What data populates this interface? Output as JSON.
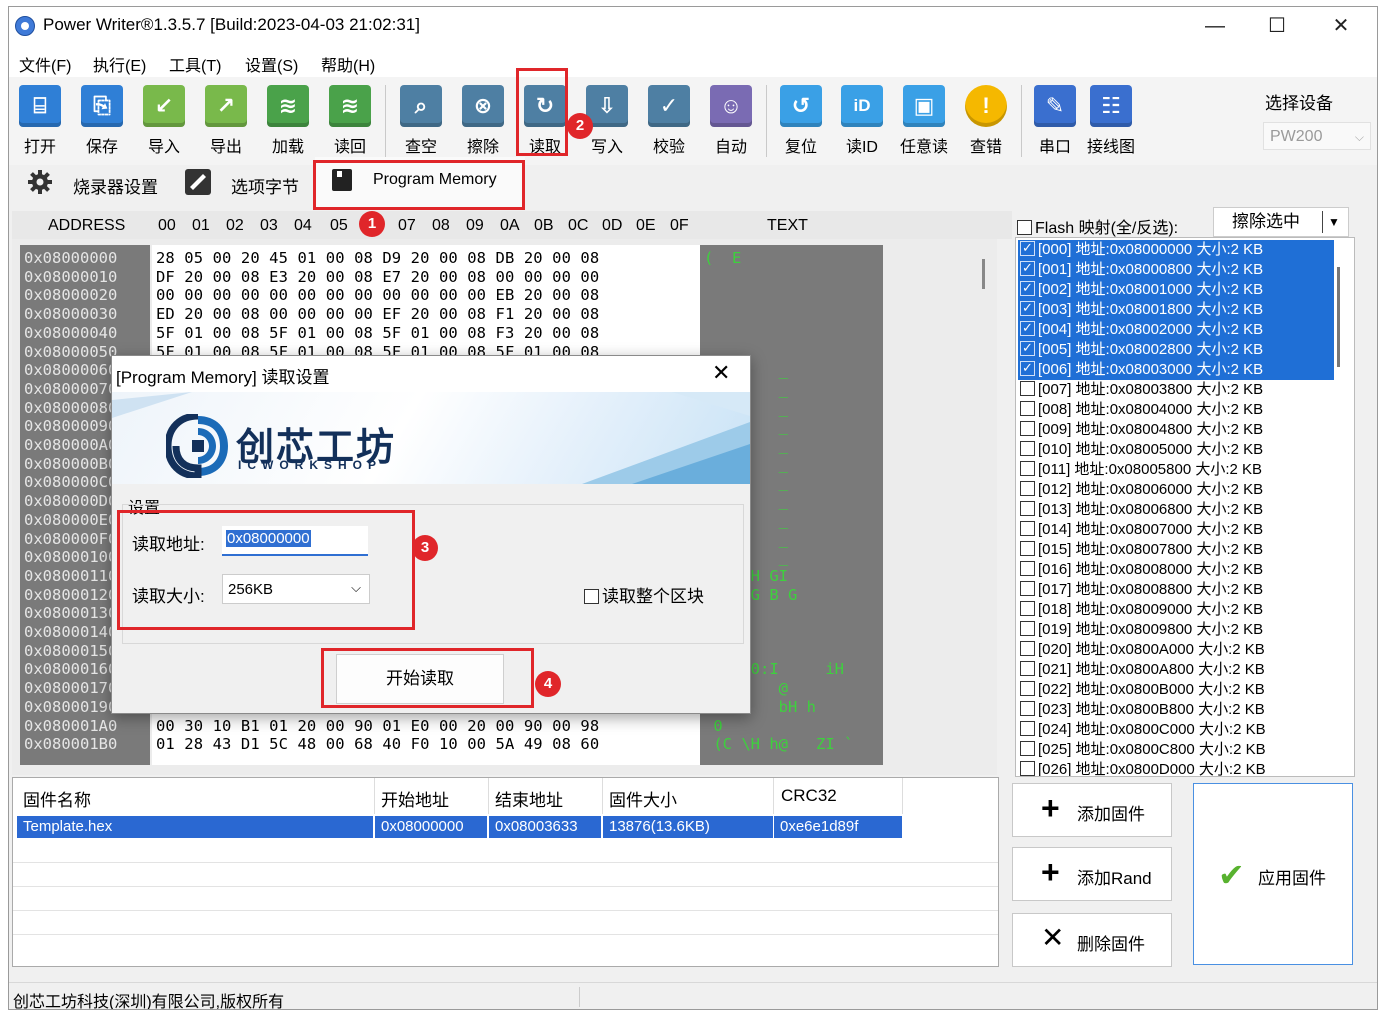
{
  "window": {
    "title": "Power Writer®1.3.5.7 [Build:2023-04-03 21:02:31]",
    "minimize_glyph": "—",
    "maximize_glyph": "☐",
    "close_glyph": "✕"
  },
  "menu": [
    "文件(F)",
    "执行(E)",
    "工具(T)",
    "设置(S)",
    "帮助(H)"
  ],
  "toolbar": {
    "buttons": [
      {
        "label": "打开",
        "icon": "open-icon",
        "color": "#2f7fd6"
      },
      {
        "label": "保存",
        "icon": "save-icon",
        "color": "#2f7fd6"
      },
      {
        "label": "导入",
        "icon": "import-icon",
        "color": "#79b94b"
      },
      {
        "label": "导出",
        "icon": "export-icon",
        "color": "#79b94b"
      },
      {
        "label": "加载",
        "icon": "load-icon",
        "color": "#4aa24a"
      },
      {
        "label": "读回",
        "icon": "readback-icon",
        "color": "#4aa24a"
      },
      {
        "label": "查空",
        "icon": "blank-check-icon",
        "color": "#4e7fa3"
      },
      {
        "label": "擦除",
        "icon": "erase-icon",
        "color": "#4e7fa3"
      },
      {
        "label": "读取",
        "icon": "read-icon",
        "color": "#4e7fa3"
      },
      {
        "label": "写入",
        "icon": "write-icon",
        "color": "#4e7fa3"
      },
      {
        "label": "校验",
        "icon": "verify-icon",
        "color": "#4e7fa3"
      },
      {
        "label": "自动",
        "icon": "robot-icon",
        "color": "#7a6bb3"
      },
      {
        "label": "复位",
        "icon": "reset-icon",
        "color": "#3aa0e6"
      },
      {
        "label": "读ID",
        "icon": "read-id-icon",
        "color": "#3aa0e6"
      },
      {
        "label": "任意读",
        "icon": "any-read-icon",
        "color": "#3aa0e6"
      },
      {
        "label": "查错",
        "icon": "warning-icon",
        "color": "#f5b800"
      },
      {
        "label": "串口",
        "icon": "serial-port-icon",
        "color": "#3a6fcf"
      },
      {
        "label": "接线图",
        "icon": "wiring-diagram-icon",
        "color": "#3a6fcf"
      }
    ],
    "device_label": "选择设备",
    "device_value": "PW200"
  },
  "tabs": [
    {
      "label": "烧录器设置",
      "icon": "gear-icon"
    },
    {
      "label": "选项字节",
      "icon": "option-bytes-icon"
    },
    {
      "label": "Program Memory",
      "icon": "chip-icon"
    }
  ],
  "hex": {
    "header_address": "ADDRESS",
    "header_cols": [
      "00",
      "01",
      "02",
      "03",
      "04",
      "05",
      "06",
      "07",
      "08",
      "09",
      "0A",
      "0B",
      "0C",
      "0D",
      "0E",
      "0F"
    ],
    "header_text": "TEXT",
    "rows": [
      {
        "addr": "0x08000000",
        "bytes": "28 05 00 20 45 01 00 08 D9 20 00 08 DB 20 00 08",
        "text": "(  E    "
      },
      {
        "addr": "0x08000010",
        "bytes": "DF 20 00 08 E3 20 00 08 E7 20 00 08 00 00 00 00",
        "text": ""
      },
      {
        "addr": "0x08000020",
        "bytes": "00 00 00 00 00 00 00 00 00 00 00 00 EB 20 00 08",
        "text": ""
      },
      {
        "addr": "0x08000030",
        "bytes": "ED 20 00 08 00 00 00 00 EF 20 00 08 F1 20 00 08",
        "text": ""
      },
      {
        "addr": "0x08000040",
        "bytes": "5F 01 00 08 5F 01 00 08 5F 01 00 08 F3 20 00 08",
        "text": ""
      },
      {
        "addr": "0x08000050",
        "bytes": "5F 01 00 08 5F 01 00 08 5F 01 00 08 5F 01 00 08",
        "text": ""
      },
      {
        "addr": "0x08000060",
        "bytes": "",
        "text": "    _   _"
      },
      {
        "addr": "0x08000070",
        "bytes": "",
        "text": "    _   _"
      },
      {
        "addr": "0x08000080",
        "bytes": "",
        "text": "    _   _"
      },
      {
        "addr": "0x08000090",
        "bytes": "",
        "text": "    _   _"
      },
      {
        "addr": "0x080000A0",
        "bytes": "",
        "text": "    _   _"
      },
      {
        "addr": "0x080000B0",
        "bytes": "",
        "text": "    _   _"
      },
      {
        "addr": "0x080000C0",
        "bytes": "",
        "text": "    _   _"
      },
      {
        "addr": "0x080000D0",
        "bytes": "",
        "text": "    _   _"
      },
      {
        "addr": "0x080000E0",
        "bytes": "",
        "text": "    _   _"
      },
      {
        "addr": "0x080000F0",
        "bytes": "",
        "text": "    _   _"
      },
      {
        "addr": "0x08000100",
        "bytes": "",
        "text": "    _   _"
      },
      {
        "addr": "0x08000110",
        "bytes": "",
        "text": "     H GI"
      },
      {
        "addr": "0x08000120",
        "bytes": "",
        "text": "   B G B G"
      },
      {
        "addr": "0x08000130",
        "bytes": "",
        "text": ""
      },
      {
        "addr": "0x08000140",
        "bytes": "",
        "text": ""
      },
      {
        "addr": "0x08000150",
        "bytes": "",
        "text": ""
      },
      {
        "addr": "0x08000160",
        "bytes": "",
        "text": "     0:I     iH"
      },
      {
        "addr": "0x08000170",
        "bytes": "",
        "text": "  D     @"
      },
      {
        "addr": "0x08000190",
        "bytes": "18 B9 01 98 B0 F5 A0 6F F1 D1 62 48 00 68 00 F4",
        "text": "    o   bH h"
      },
      {
        "addr": "0x080001A0",
        "bytes": "00 30 10 B1 01 20 00 90 01 E0 00 20 00 90 00 98",
        "text": " 0"
      },
      {
        "addr": "0x080001B0",
        "bytes": "01 28 43 D1 5C 48 00 68 40 F0 10 00 5A 49 08 60",
        "text": " (C \\H h@   ZI `"
      }
    ]
  },
  "flash": {
    "header_checkbox_label": "Flash 映射(全/反选):",
    "erase_button": "擦除选中",
    "sectors": [
      {
        "label": "[000] 地址:0x08000000 大小:2 KB",
        "selected": true
      },
      {
        "label": "[001] 地址:0x08000800 大小:2 KB",
        "selected": true
      },
      {
        "label": "[002] 地址:0x08001000 大小:2 KB",
        "selected": true
      },
      {
        "label": "[003] 地址:0x08001800 大小:2 KB",
        "selected": true
      },
      {
        "label": "[004] 地址:0x08002000 大小:2 KB",
        "selected": true
      },
      {
        "label": "[005] 地址:0x08002800 大小:2 KB",
        "selected": true
      },
      {
        "label": "[006] 地址:0x08003000 大小:2 KB",
        "selected": true
      },
      {
        "label": "[007] 地址:0x08003800 大小:2 KB",
        "selected": false
      },
      {
        "label": "[008] 地址:0x08004000 大小:2 KB",
        "selected": false
      },
      {
        "label": "[009] 地址:0x08004800 大小:2 KB",
        "selected": false
      },
      {
        "label": "[010] 地址:0x08005000 大小:2 KB",
        "selected": false
      },
      {
        "label": "[011] 地址:0x08005800 大小:2 KB",
        "selected": false
      },
      {
        "label": "[012] 地址:0x08006000 大小:2 KB",
        "selected": false
      },
      {
        "label": "[013] 地址:0x08006800 大小:2 KB",
        "selected": false
      },
      {
        "label": "[014] 地址:0x08007000 大小:2 KB",
        "selected": false
      },
      {
        "label": "[015] 地址:0x08007800 大小:2 KB",
        "selected": false
      },
      {
        "label": "[016] 地址:0x08008000 大小:2 KB",
        "selected": false
      },
      {
        "label": "[017] 地址:0x08008800 大小:2 KB",
        "selected": false
      },
      {
        "label": "[018] 地址:0x08009000 大小:2 KB",
        "selected": false
      },
      {
        "label": "[019] 地址:0x08009800 大小:2 KB",
        "selected": false
      },
      {
        "label": "[020] 地址:0x0800A000 大小:2 KB",
        "selected": false
      },
      {
        "label": "[021] 地址:0x0800A800 大小:2 KB",
        "selected": false
      },
      {
        "label": "[022] 地址:0x0800B000 大小:2 KB",
        "selected": false
      },
      {
        "label": "[023] 地址:0x0800B800 大小:2 KB",
        "selected": false
      },
      {
        "label": "[024] 地址:0x0800C000 大小:2 KB",
        "selected": false
      },
      {
        "label": "[025] 地址:0x0800C800 大小:2 KB",
        "selected": false
      },
      {
        "label": "[026] 地址:0x0800D000 大小:2 KB",
        "selected": false
      }
    ]
  },
  "firmware": {
    "columns": [
      "固件名称",
      "开始地址",
      "结束地址",
      "固件大小",
      "CRC32"
    ],
    "rows": [
      [
        "Template.hex",
        "0x08000000",
        "0x08003633",
        "13876(13.6KB)",
        "0xe6e1d89f"
      ]
    ],
    "add_firmware": "添加固件",
    "add_rand": "添加Rand",
    "delete_firmware": "删除固件",
    "apply_firmware": "应用固件"
  },
  "status": "创芯工坊科技(深圳)有限公司,版权所有",
  "dialog": {
    "title": "[Program Memory] 读取设置",
    "close_glyph": "✕",
    "logo_cn": "创芯工坊",
    "logo_en": "ICWORKSHOP",
    "section": "设置",
    "address_label": "读取地址:",
    "address_value": "0x08000000",
    "size_label": "读取大小:",
    "size_value": "256KB",
    "whole_block_label": "读取整个区块",
    "start_button": "开始读取"
  },
  "annotations": [
    "1",
    "2",
    "3",
    "4"
  ],
  "colors": {
    "highlight": "#e0262a",
    "selection": "#1f6fd6",
    "hex_text": "#3dd13d"
  }
}
